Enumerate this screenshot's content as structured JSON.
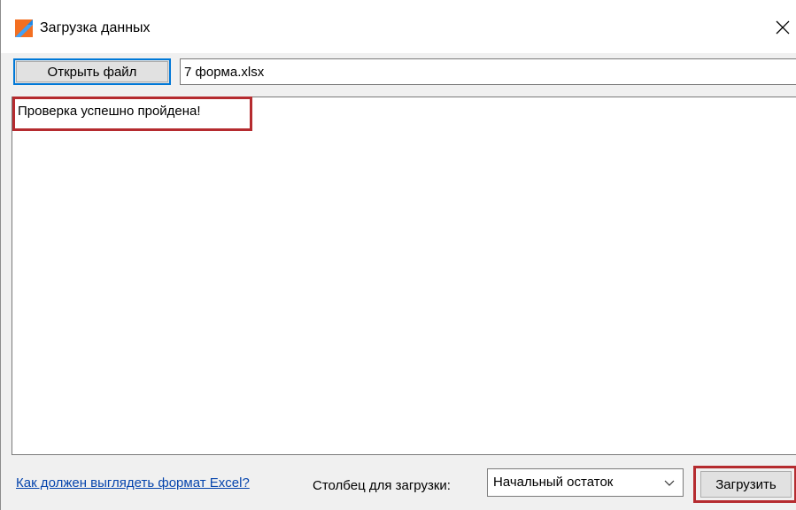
{
  "window": {
    "title": "Загрузка данных",
    "icon": "app-logo-icon",
    "close_icon": "close-icon"
  },
  "toolbar": {
    "open_file_label": "Открыть файл",
    "file_name_value": "7 форма.xlsx"
  },
  "log": {
    "message": "Проверка успешно пройдена!"
  },
  "footer": {
    "format_link": "Как должен выглядеть формат Excel?",
    "column_label": "Столбец для загрузки:",
    "column_selected": "Начальный остаток",
    "load_label": "Загрузить"
  },
  "colors": {
    "accent": "#0078d7",
    "highlight": "#b52b2f",
    "link": "#0645ad",
    "logo_orange": "#f36f21",
    "logo_blue": "#1e88e5"
  }
}
